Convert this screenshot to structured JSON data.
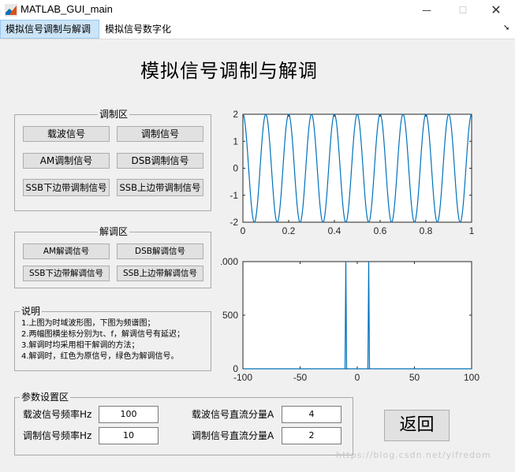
{
  "window": {
    "title": "MATLAB_GUI_main",
    "minimize": "—",
    "maximize": "☐",
    "close": "✕"
  },
  "tabs": [
    {
      "label": "模拟信号调制与解调",
      "selected": true
    },
    {
      "label": "模拟信号数字化",
      "selected": false
    }
  ],
  "main_title": "模拟信号调制与解调",
  "modulation": {
    "title": "调制区",
    "buttons": [
      "载波信号",
      "调制信号",
      "AM调制信号",
      "DSB调制信号",
      "SSB下边带调制信号",
      "SSB上边带调制信号"
    ]
  },
  "demodulation": {
    "title": "解调区",
    "buttons": [
      "AM解调信号",
      "DSB解调信号",
      "SSB下边带解调信号",
      "SSB上边带解调信号"
    ]
  },
  "notes": {
    "title": "说明",
    "lines": [
      "1.上图为时域波形图，下图为频谱图；",
      "2.两幅图横坐标分别为t、f，解调信号有延迟；",
      "3.解调时均采用相干解调的方法；",
      "4.解调时，红色为原信号，绿色为解调信号。"
    ]
  },
  "params": {
    "title": "参数设置区",
    "carrier_freq_label": "载波信号频率Hz",
    "carrier_freq_value": "100",
    "mod_freq_label": "调制信号频率Hz",
    "mod_freq_value": "10",
    "carrier_dc_label": "载波信号直流分量A",
    "carrier_dc_value": "4",
    "mod_dc_label": "调制信号直流分量A",
    "mod_dc_value": "2"
  },
  "return_button": "返回",
  "watermark": "https://blog.csdn.net/yifredom",
  "colors": {
    "line": "#0072bd",
    "tab_selected": "#cce4f7"
  },
  "chart_data": [
    {
      "type": "line",
      "title": "",
      "xlabel": "",
      "ylabel": "",
      "xlim": [
        0,
        1
      ],
      "ylim": [
        -2,
        2
      ],
      "xticks": [
        "0",
        "0.2",
        "0.4",
        "0.6",
        "0.8",
        "1"
      ],
      "yticks": [
        "-2",
        "-1",
        "0",
        "1",
        "2"
      ],
      "series": [
        {
          "function": "2*cos(2*pi*10*t)",
          "amplitude": 2,
          "frequency": 10
        }
      ]
    },
    {
      "type": "line",
      "title": "",
      "xlabel": "",
      "ylabel": "",
      "xlim": [
        -100,
        100
      ],
      "ylim": [
        0,
        1000
      ],
      "xticks": [
        "-100",
        "-50",
        "0",
        "50",
        "100"
      ],
      "yticks": [
        "0",
        "500",
        "1000"
      ],
      "series": [
        {
          "spikes": [
            {
              "x": -10,
              "y": 1000
            },
            {
              "x": 10,
              "y": 1000
            }
          ]
        }
      ]
    }
  ]
}
